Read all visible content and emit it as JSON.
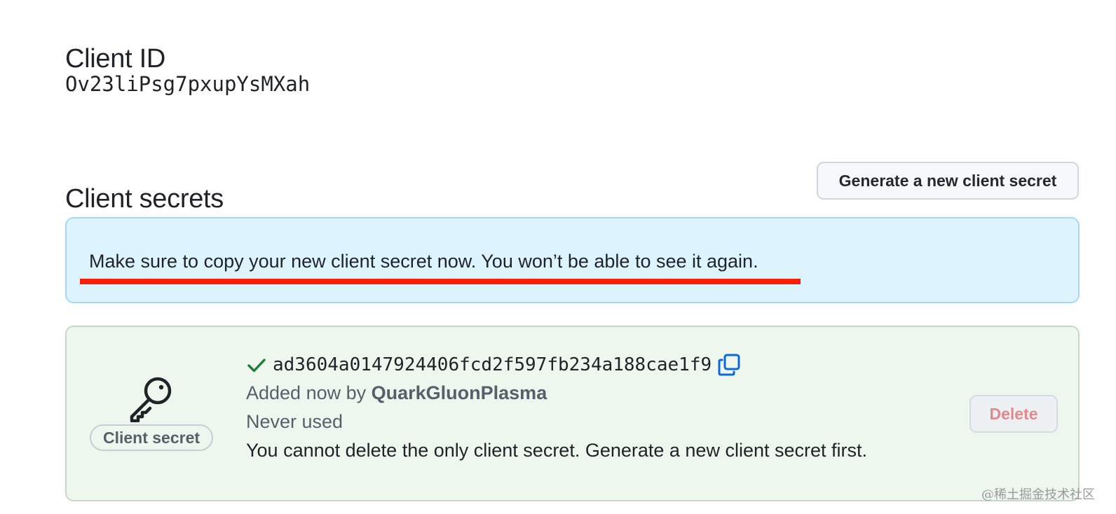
{
  "client_id": {
    "title": "Client ID",
    "value": "Ov23liPsg7pxupYsMXah"
  },
  "client_secrets": {
    "title": "Client secrets",
    "generate_button_label": "Generate a new client secret",
    "flash_message": "Make sure to copy your new client secret now. You won’t be able to see it again.",
    "secret": {
      "badge_label": "Client secret",
      "value": "ad3604a0147924406fcd2f597fb234a188cae1f9",
      "added_prefix": "Added now by ",
      "added_by": "QuarkGluonPlasma",
      "usage": "Never used",
      "notice": "You cannot delete the only client secret. Generate a new client secret first.",
      "delete_button_label": "Delete",
      "icons": {
        "key": "key-icon",
        "check": "check-icon",
        "copy": "copy-icon"
      }
    }
  },
  "colors": {
    "flash_background": "#ddf4ff",
    "card_background": "#eef7ee",
    "check_green": "#1a7f37",
    "copy_blue": "#0969da",
    "annotation_red": "#fa1d0a"
  },
  "watermark": "@稀土掘金技术社区"
}
